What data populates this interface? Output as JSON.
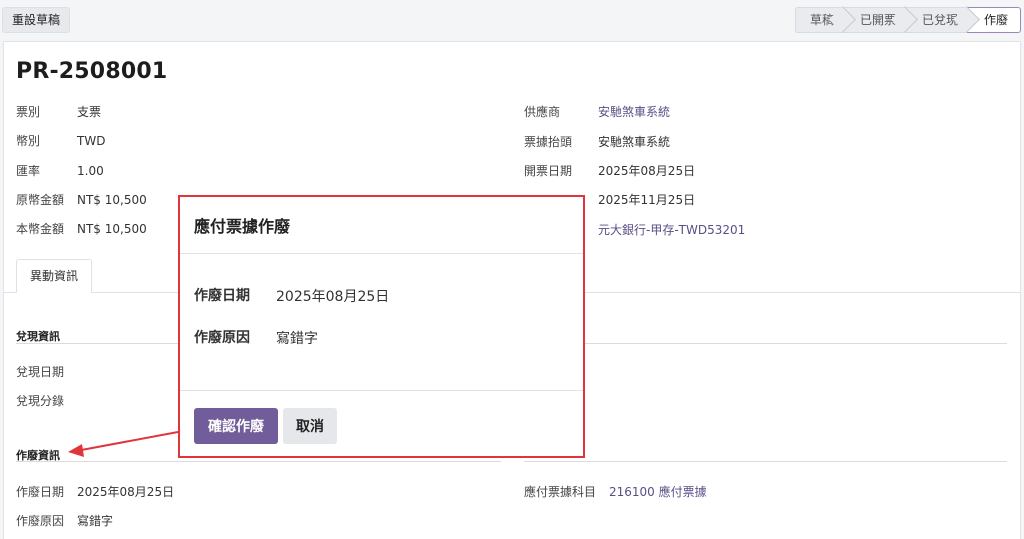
{
  "toolbar": {
    "reset_label": "重設草稿"
  },
  "statusbar": {
    "steps": [
      "草稿",
      "已開票",
      "已兌現",
      "作廢"
    ],
    "active": "作廢"
  },
  "record": {
    "title": "PR-2508001"
  },
  "left_fields": [
    {
      "label": "票別",
      "value": "支票"
    },
    {
      "label": "幣別",
      "value": "TWD"
    },
    {
      "label": "匯率",
      "value": "1.00"
    },
    {
      "label": "原幣金額",
      "value": "NT$ 10,500"
    },
    {
      "label": "本幣金額",
      "value": "NT$ 10,500"
    }
  ],
  "right_fields": [
    {
      "label": "供應商",
      "value": "安馳煞車系統"
    },
    {
      "label": "票據抬頭",
      "value": "安馳煞車系統"
    },
    {
      "label": "開票日期",
      "value": "2025年08月25日"
    },
    {
      "label": "",
      "value": "2025年11月25日"
    },
    {
      "label": "",
      "value": "元大銀行-甲存-TWD53201"
    }
  ],
  "tabs": [
    {
      "label": "異動資訊"
    }
  ],
  "cash_section": {
    "title": "兌現資訊",
    "fields": [
      {
        "label": "兌現日期",
        "value": ""
      },
      {
        "label": "兌現分錄",
        "value": ""
      }
    ]
  },
  "void_section": {
    "title": "作廢資訊",
    "left": [
      {
        "label": "作廢日期",
        "value": "2025年08月25日"
      },
      {
        "label": "作廢原因",
        "value": "寫錯字"
      }
    ],
    "right": [
      {
        "label": "應付票據科目",
        "value": "216100 應付票據"
      }
    ]
  },
  "dialog": {
    "title": "應付票據作廢",
    "fields": [
      {
        "label": "作廢日期",
        "value": "2025年08月25日"
      },
      {
        "label": "作廢原因",
        "value": "寫錯字"
      }
    ],
    "confirm_label": "確認作廢",
    "cancel_label": "取消"
  },
  "colors": {
    "accent": "#715d9a",
    "link": "#5b4e86",
    "highlight": "#e0363b"
  }
}
